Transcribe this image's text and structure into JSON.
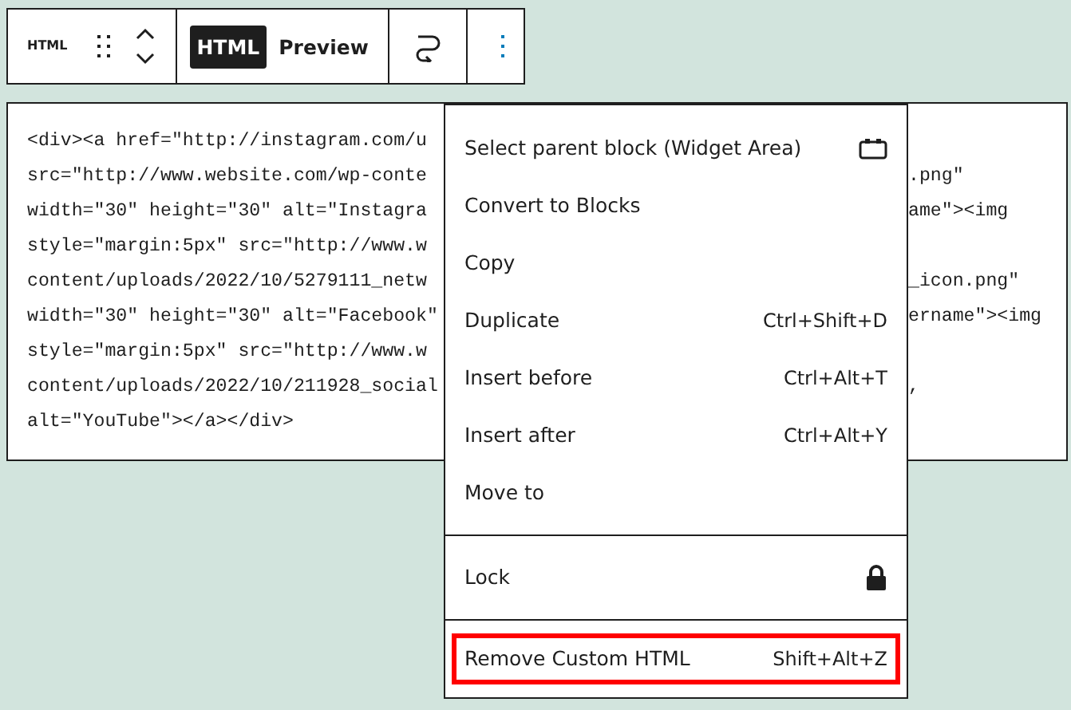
{
  "toolbar": {
    "block_label": "HTML",
    "tabs": [
      {
        "label": "HTML",
        "selected": true
      },
      {
        "label": "Preview",
        "selected": false
      }
    ]
  },
  "code_lines": [
    {
      "left": "<div><a href=\"http://instagram.com/u"
    },
    {
      "left": "src=\"http://www.website.com/wp-conte",
      "right": ".png\""
    },
    {
      "left": "width=\"30\" height=\"30\" alt=\"Instagra",
      "right": "ame\"><img"
    },
    {
      "left": "style=\"margin:5px\" src=\"http://www.w"
    },
    {
      "left": "content/uploads/2022/10/5279111_netw",
      "right": "_icon.png\""
    },
    {
      "left": "width=\"30\" height=\"30\" alt=\"Facebook\"",
      "right": "ername\"><img"
    },
    {
      "left": "style=\"margin:5px\" src=\"http://www.w"
    },
    {
      "left": "content/uploads/2022/10/211928_social",
      "right": ","
    },
    {
      "left": "alt=\"YouTube\"></a></div>"
    }
  ],
  "menu": {
    "sections": [
      {
        "items": [
          {
            "label": "Select parent block (Widget Area)",
            "kind": "parent",
            "outlined": false
          },
          {
            "label": "Convert to Blocks",
            "kind": "plain",
            "outlined": false
          },
          {
            "label": "Copy",
            "kind": "plain",
            "outlined": false
          },
          {
            "label": "Duplicate",
            "shortcut": "Ctrl+Shift+D",
            "kind": "plain",
            "outlined": false
          },
          {
            "label": "Insert before",
            "shortcut": "Ctrl+Alt+T",
            "kind": "plain",
            "outlined": false
          },
          {
            "label": "Insert after",
            "shortcut": "Ctrl+Alt+Y",
            "kind": "plain",
            "outlined": false
          },
          {
            "label": "Move to",
            "kind": "plain",
            "outlined": false
          }
        ]
      },
      {
        "items": [
          {
            "label": "Lock",
            "kind": "lock",
            "outlined": false
          }
        ]
      },
      {
        "items": [
          {
            "label": "Remove Custom HTML",
            "shortcut": "Shift+Alt+Z",
            "kind": "plain",
            "outlined": true
          }
        ]
      }
    ]
  }
}
